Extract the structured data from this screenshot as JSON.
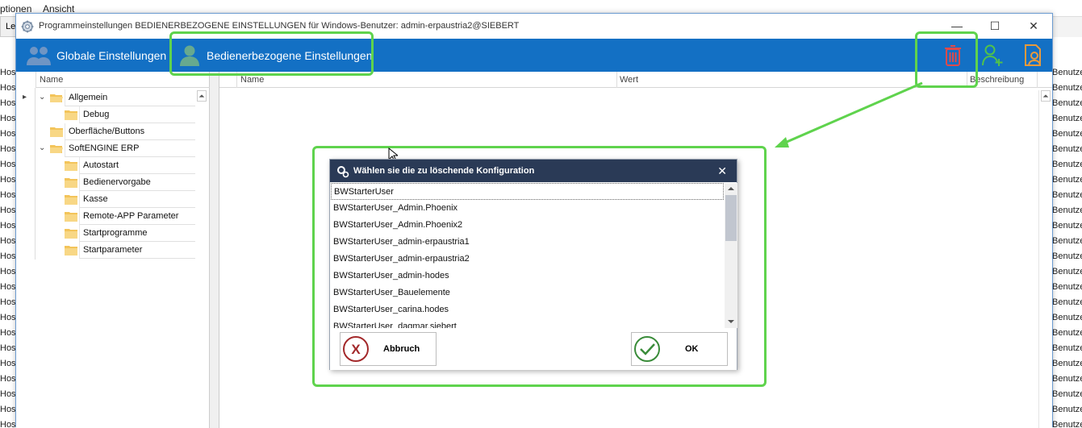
{
  "background_app": {
    "menu": [
      "ptionen",
      "Ansicht"
    ],
    "toolbar_fragment": "Le",
    "left_cells": [
      "Hos",
      "Hos",
      "Hos",
      "Hos",
      "Hos",
      "Hos",
      "Hos",
      "Hos",
      "Hos",
      "Hos",
      "Hos",
      "Hos",
      "Hos",
      "Hos",
      "Hos",
      "Hos",
      "Hos",
      "Hos",
      "Hos",
      "Hos",
      "Hos",
      "Hos",
      "Hos",
      "Hos"
    ],
    "right_cells": [
      "Benutze",
      "Benutze",
      "Benutze",
      "Benutze",
      "Benutze",
      "Benutze",
      "Benutze",
      "Benutze",
      "Benutze",
      "Benutze",
      "Benutze",
      "Benutze",
      "Benutze",
      "Benutze",
      "Benutze",
      "Benutze",
      "Benutze",
      "Benutze",
      "Benutze",
      "Benutze",
      "Benutze",
      "Benutze",
      "Benutze",
      "Benutze"
    ]
  },
  "window": {
    "title": "Programmeinstellungen BEDIENERBEZOGENE EINSTELLUNGEN für Windows-Benutzer: admin-erpaustria2@SIEBERT",
    "minimize_glyph": "—",
    "maximize_glyph": "☐",
    "close_glyph": "✕"
  },
  "ribbon": {
    "global_label": "Globale Einstellungen",
    "user_label": "Bedienerbezogene Einstellungen",
    "accent": "#1370c4",
    "icons": [
      "trash-icon",
      "add-user-icon",
      "user-document-icon"
    ]
  },
  "tree": {
    "header": "Name",
    "items": [
      {
        "label": "Allgemein",
        "level": 0,
        "expanded": true
      },
      {
        "label": "Debug",
        "level": 1
      },
      {
        "label": "Oberfläche/Buttons",
        "level": 0
      },
      {
        "label": "SoftENGINE ERP",
        "level": 0,
        "expanded": true
      },
      {
        "label": "Autostart",
        "level": 1
      },
      {
        "label": "Bedienervorgabe",
        "level": 1
      },
      {
        "label": "Kasse",
        "level": 1
      },
      {
        "label": "Remote-APP Parameter",
        "level": 1
      },
      {
        "label": "Startprogramme",
        "level": 1
      },
      {
        "label": "Startparameter",
        "level": 1
      }
    ]
  },
  "grid": {
    "columns": [
      "Name",
      "Wert",
      "Beschreibung"
    ]
  },
  "dialog": {
    "title": "Wählen sie die zu löschende Konfiguration",
    "close_glyph": "✕",
    "items": [
      "BWStarterUser",
      "BWStarterUser_Admin.Phoenix",
      "BWStarterUser_Admin.Phoenix2",
      "BWStarterUser_admin-erpaustria1",
      "BWStarterUser_admin-erpaustria2",
      "BWStarterUser_admin-hodes",
      "BWStarterUser_Bauelemente",
      "BWStarterUser_carina.hodes",
      "BWStarterUser_dagmar.siebert"
    ],
    "selected_index": 0,
    "cancel_label": "Abbruch",
    "ok_label": "OK",
    "cancel_glyph": "X"
  },
  "annotation_color": "#5fd34d"
}
